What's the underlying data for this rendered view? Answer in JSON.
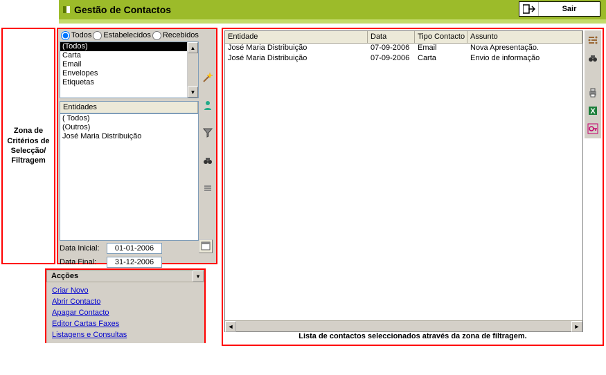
{
  "topbar": {
    "title": "Gestão de Contactos",
    "exit_label": "Sair"
  },
  "annotations": {
    "left_label": "Zona de Critérios de Selecção/ Filtragem",
    "bottom_label": "Lista de contactos seleccionados através da zona de filtragem."
  },
  "filter": {
    "radios": {
      "all": "Todos",
      "established": "Estabelecidos",
      "received": "Recebidos",
      "selected": "all"
    },
    "tipos": [
      "(Todos)",
      "Carta",
      "Email",
      "Envelopes",
      "Etiquetas"
    ],
    "tipos_selected": 0,
    "entidades_header": "Entidades",
    "entidades": [
      "( Todos)",
      "(Outros)",
      "José Maria Distribuição"
    ],
    "date_initial_label": "Data Inicial:",
    "date_initial": "01-01-2006",
    "date_final_label": "Data Final:",
    "date_final": "31-12-2006"
  },
  "actions": {
    "header": "Acções",
    "items": [
      "Criar Novo",
      "Abrir Contacto",
      "Apagar Contacto",
      "Editor Cartas Faxes",
      "Listagens e Consultas"
    ]
  },
  "results": {
    "columns": [
      "Entidade",
      "Data",
      "Tipo Contacto",
      "Assunto"
    ],
    "rows": [
      [
        "José Maria Distribuição",
        "07-09-2006",
        "Email",
        "Nova Apresentação."
      ],
      [
        "José Maria Distribuição",
        "07-09-2006",
        "Carta",
        "Envio de informação"
      ]
    ]
  },
  "icons": {
    "filter_side": [
      "wand-icon",
      "person-icon",
      "filter-icon",
      "binoculars-icon",
      "bars-icon"
    ],
    "right_side": [
      "settings-icon",
      "binoculars-icon",
      "print-icon",
      "excel-icon",
      "key-icon"
    ]
  }
}
